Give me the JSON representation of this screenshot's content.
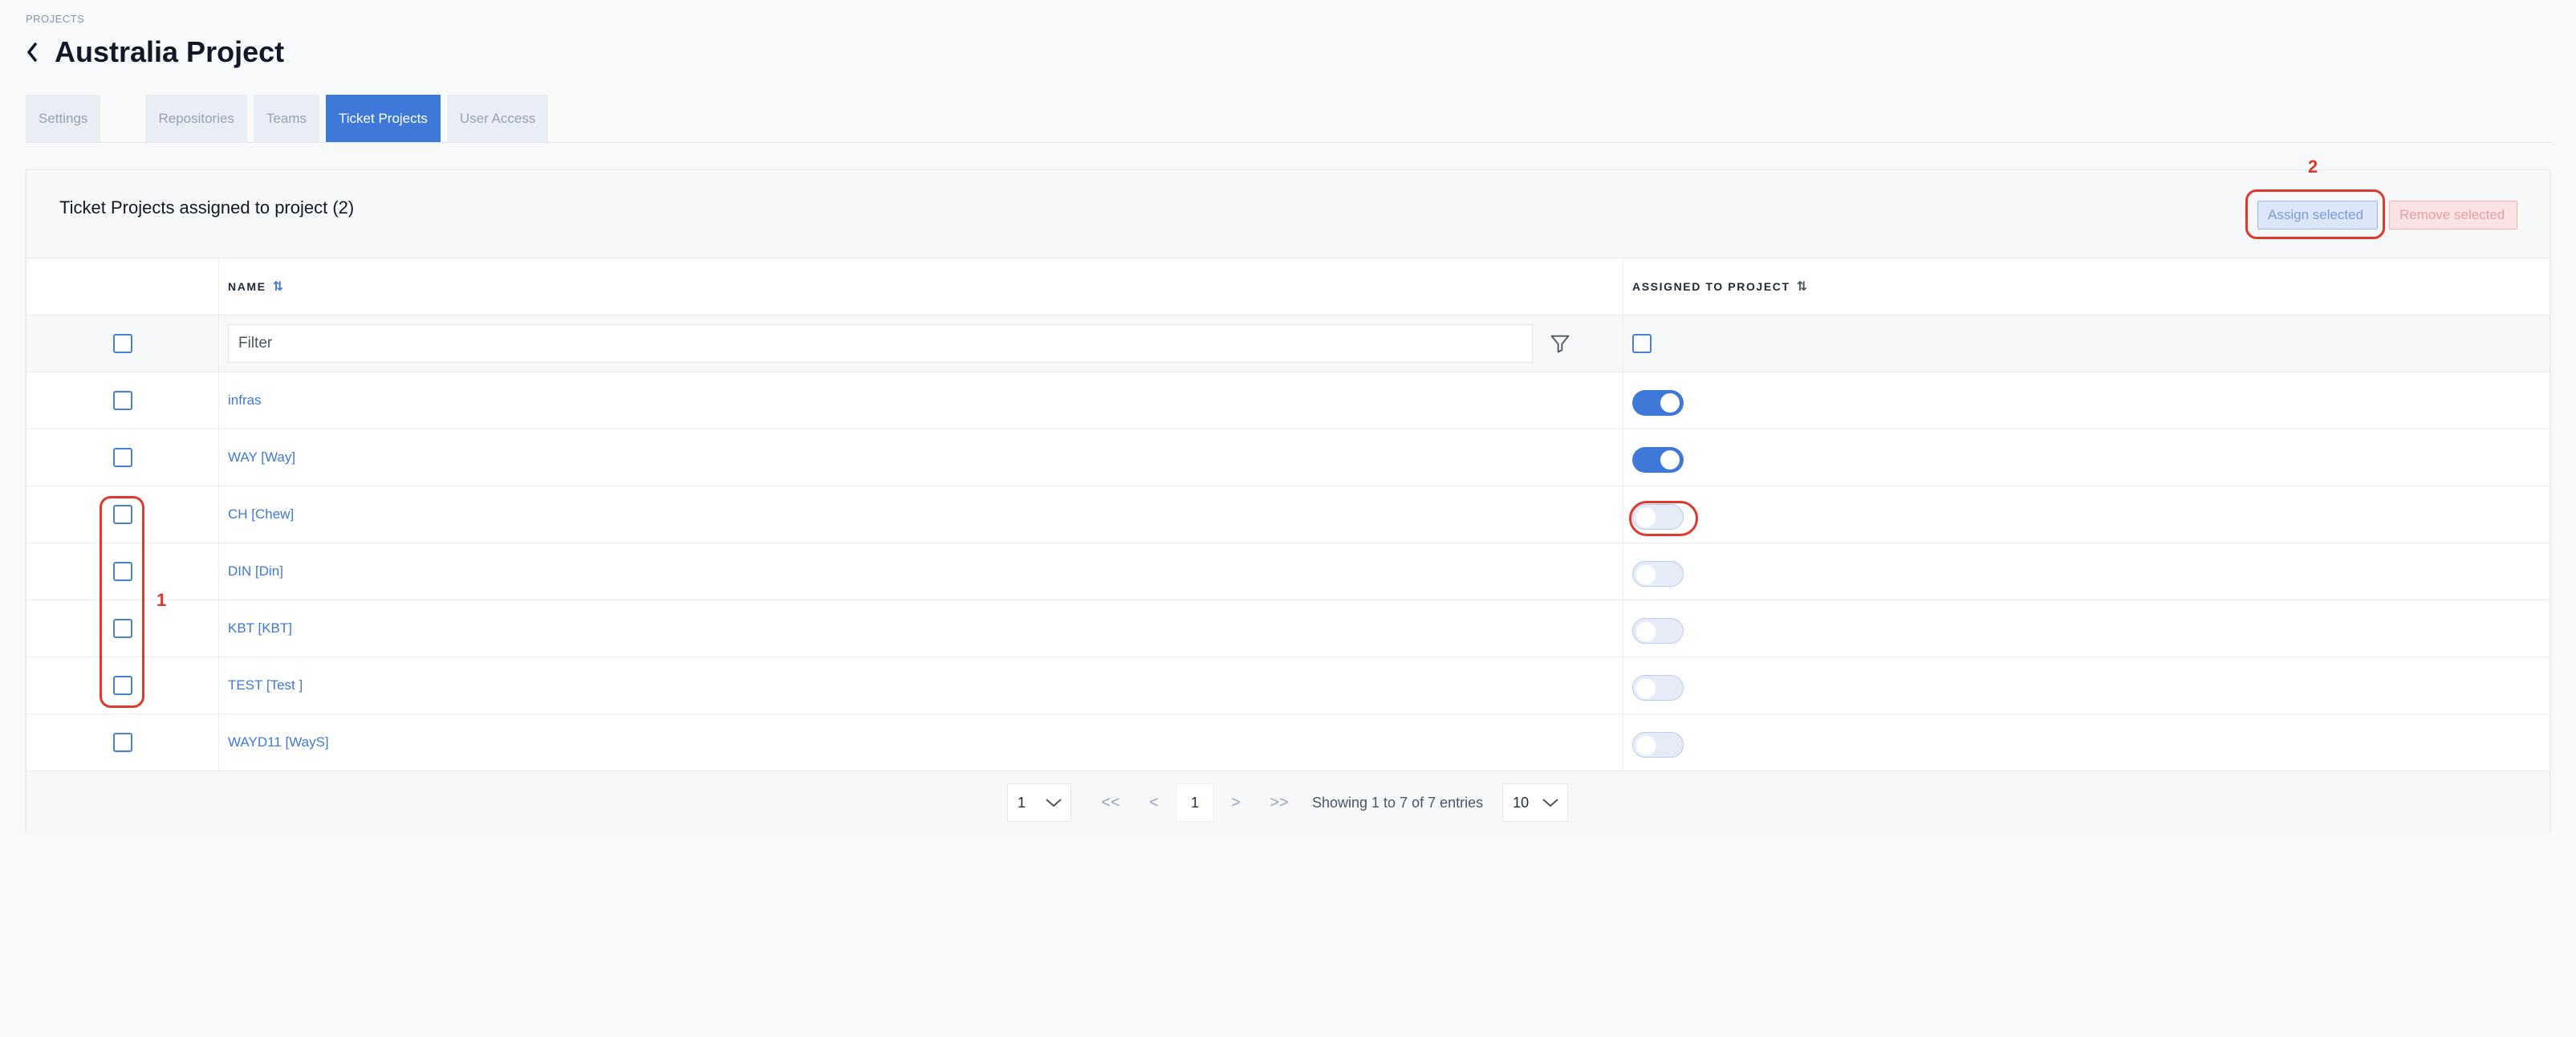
{
  "breadcrumb": "PROJECTS",
  "page": {
    "title": "Australia Project"
  },
  "tabs": [
    {
      "label": "Settings",
      "active": false
    },
    {
      "label": "Repositories",
      "active": false
    },
    {
      "label": "Teams",
      "active": false
    },
    {
      "label": "Ticket Projects",
      "active": true
    },
    {
      "label": "User Access",
      "active": false
    }
  ],
  "panel": {
    "title": "Ticket Projects assigned to project (2)",
    "assign_label": "Assign selected",
    "remove_label": "Remove selected"
  },
  "table": {
    "col_name": "NAME",
    "col_assigned": "ASSIGNED TO PROJECT",
    "filter_placeholder": "Filter",
    "rows": [
      {
        "name": "infras",
        "assigned": true
      },
      {
        "name": "WAY [Way]",
        "assigned": true
      },
      {
        "name": "CH [Chew]",
        "assigned": false
      },
      {
        "name": "DIN [Din]",
        "assigned": false
      },
      {
        "name": "KBT [KBT]",
        "assigned": false
      },
      {
        "name": "TEST [Test ]",
        "assigned": false
      },
      {
        "name": "WAYD11 [WayS]",
        "assigned": false
      }
    ]
  },
  "pagination": {
    "page_select": "1",
    "first": "<<",
    "prev": "<",
    "current": "1",
    "next": ">",
    "last": ">>",
    "summary": "Showing 1 to 7 of 7 entries",
    "page_size": "10"
  },
  "annotations": {
    "one": "1",
    "two": "2",
    "color": "#e0382a"
  },
  "colors": {
    "accent": "#3e79d9",
    "danger_soft": "#fbe3e4"
  }
}
